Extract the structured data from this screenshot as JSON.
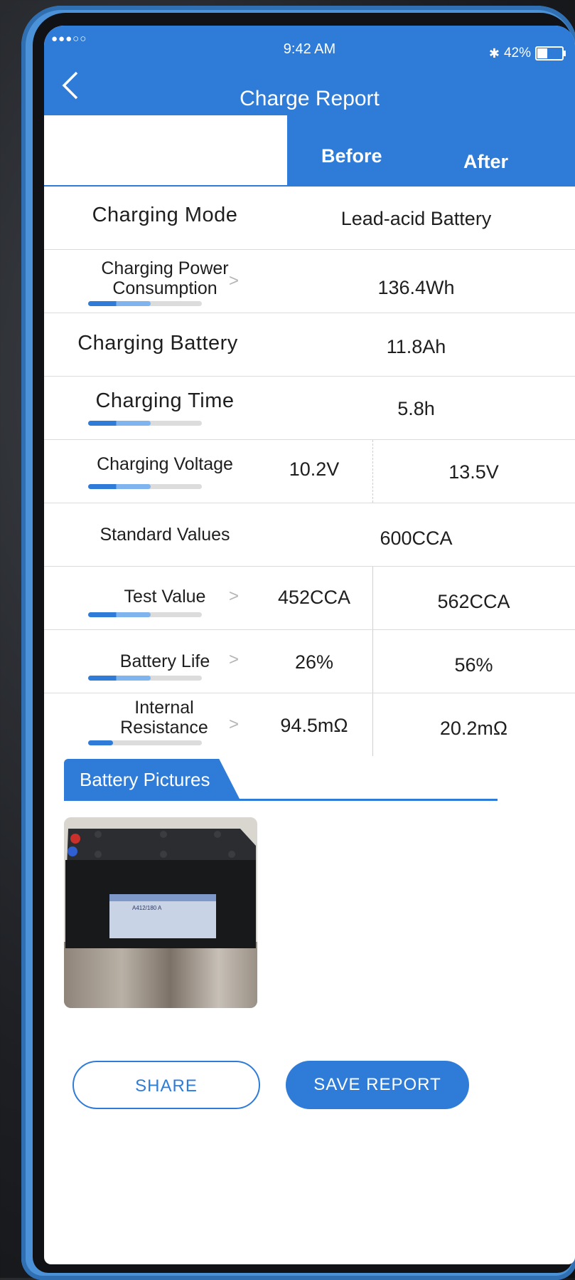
{
  "status": {
    "signal": "●●●○○",
    "time": "9:42 AM",
    "bluetooth": "✱",
    "battery_text": "42%"
  },
  "header": {
    "title": "Charge Report",
    "back_icon": "chevron-left-icon"
  },
  "tabs": {
    "before": "Before",
    "after": "After"
  },
  "rows": [
    {
      "label": "Charging Mode",
      "value": "Lead-acid Battery"
    },
    {
      "label": "Charging Power Consumption",
      "value": "136.4Wh",
      "level": 0.55
    },
    {
      "label": "Charging  Battery",
      "value": "11.8Ah"
    },
    {
      "label": "Charging Time",
      "value": "5.8h",
      "level": 0.55
    },
    {
      "label": "Charging Voltage",
      "before": "10.2V",
      "after": "13.5V",
      "level": 0.55
    },
    {
      "label": "Standard Values",
      "value": "600CCA"
    },
    {
      "label": "Test Value",
      "before": "452CCA",
      "after": "562CCA",
      "level": 0.55
    },
    {
      "label": "Battery Life",
      "before": "26%",
      "after": "56%",
      "level": 0.55
    },
    {
      "label": "Internal Resistance",
      "before": "94.5mΩ",
      "after": "20.2mΩ",
      "level": 0.22
    }
  ],
  "pictures": {
    "title": "Battery Pictures",
    "battery_label": "A412/180 A"
  },
  "actions": {
    "share": "SHARE",
    "save": "SAVE REPORT"
  },
  "colors": {
    "accent": "#2f7bd8",
    "bar_light": "#7fb4ee",
    "track": "#dcdcdc"
  }
}
